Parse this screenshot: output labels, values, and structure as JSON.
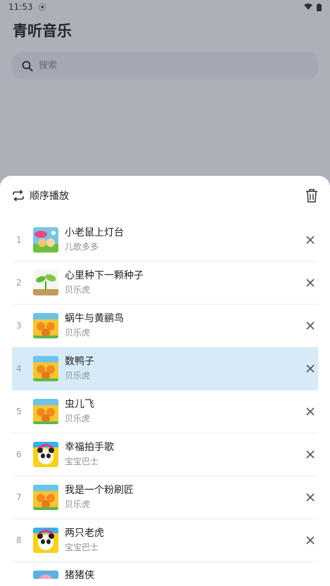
{
  "status": {
    "time": "11:53"
  },
  "app": {
    "title": "青听音乐"
  },
  "search": {
    "placeholder": "搜索"
  },
  "sheet": {
    "mode_label": "顺序播放",
    "icons": {
      "mode": "repeat-icon",
      "clear": "trash-icon",
      "remove": "close-icon"
    },
    "active_color": "#d6ebf7",
    "songs": [
      {
        "index": "1",
        "title": "小老鼠上灯台",
        "artist": "儿歌多多",
        "cover": "cartoon-cover"
      },
      {
        "index": "2",
        "title": "心里种下一颗种子",
        "artist": "贝乐虎",
        "cover": "sprout-cover"
      },
      {
        "index": "3",
        "title": "蜗牛与黄鹂鸟",
        "artist": "贝乐虎",
        "cover": "tiger-cover"
      },
      {
        "index": "4",
        "title": "数鸭子",
        "artist": "贝乐虎",
        "cover": "tiger-cover"
      },
      {
        "index": "5",
        "title": "虫儿飞",
        "artist": "贝乐虎",
        "cover": "tiger-cover"
      },
      {
        "index": "6",
        "title": "幸福拍手歌",
        "artist": "宝宝巴士",
        "cover": "panda-cover"
      },
      {
        "index": "7",
        "title": "我是一个粉刷匠",
        "artist": "贝乐虎",
        "cover": "tiger-cover"
      },
      {
        "index": "8",
        "title": "两只老虎",
        "artist": "宝宝巴士",
        "cover": "panda-cover"
      },
      {
        "index": "",
        "title": "猪猪侠",
        "artist": "",
        "cover": "pig-cover"
      }
    ]
  }
}
